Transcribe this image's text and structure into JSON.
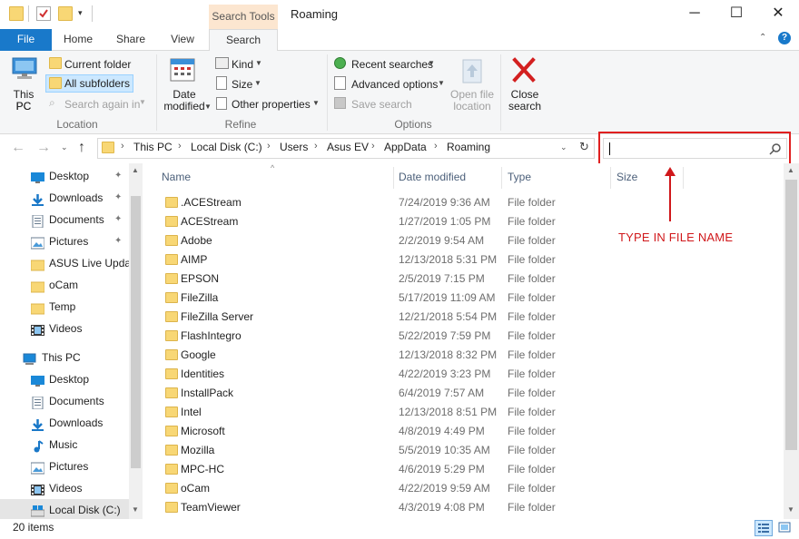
{
  "window": {
    "title": "Roaming",
    "context_tab": "Search Tools",
    "minimize": "─",
    "maximize": "☐",
    "close": "✕"
  },
  "ribbon_tabs": {
    "file": "File",
    "home": "Home",
    "share": "Share",
    "view": "View",
    "search": "Search"
  },
  "ribbon": {
    "location": {
      "this_pc": "This PC",
      "current_folder": "Current folder",
      "all_subfolders": "All subfolders",
      "search_again": "Search again in",
      "group_label": "Location"
    },
    "refine": {
      "date_modified_1": "Date",
      "date_modified_2": "modified",
      "kind": "Kind",
      "size": "Size",
      "other_properties": "Other properties",
      "group_label": "Refine"
    },
    "options": {
      "recent_searches": "Recent searches",
      "advanced_options": "Advanced options",
      "save_search": "Save search",
      "open_file_location_1": "Open file",
      "open_file_location_2": "location",
      "group_label": "Options"
    },
    "close_search_1": "Close",
    "close_search_2": "search"
  },
  "address": {
    "breadcrumbs": [
      "This PC",
      "Local Disk (C:)",
      "Users",
      "Asus EV",
      "AppData",
      "Roaming"
    ],
    "search_value": ""
  },
  "nav": {
    "quick_access": [
      {
        "label": "Desktop",
        "icon": "desktop-icon",
        "pinned": true
      },
      {
        "label": "Downloads",
        "icon": "download-icon",
        "pinned": true
      },
      {
        "label": "Documents",
        "icon": "documents-icon",
        "pinned": true
      },
      {
        "label": "Pictures",
        "icon": "pictures-icon",
        "pinned": true
      },
      {
        "label": "ASUS Live Updat",
        "icon": "folder-icon",
        "pinned": false
      },
      {
        "label": "oCam",
        "icon": "folder-icon",
        "pinned": false
      },
      {
        "label": "Temp",
        "icon": "folder-icon",
        "pinned": false
      },
      {
        "label": "Videos",
        "icon": "videos-icon",
        "pinned": false
      }
    ],
    "this_pc": "This PC",
    "this_pc_items": [
      {
        "label": "Desktop",
        "icon": "desktop-icon"
      },
      {
        "label": "Documents",
        "icon": "documents-icon"
      },
      {
        "label": "Downloads",
        "icon": "download-icon"
      },
      {
        "label": "Music",
        "icon": "music-icon"
      },
      {
        "label": "Pictures",
        "icon": "pictures-icon"
      },
      {
        "label": "Videos",
        "icon": "videos-icon"
      },
      {
        "label": "Local Disk (C:)",
        "icon": "drive-icon"
      }
    ],
    "pin_glyph": "📌"
  },
  "columns": {
    "name": "Name",
    "date_modified": "Date modified",
    "type": "Type",
    "size": "Size"
  },
  "files": [
    {
      "name": ".ACEStream",
      "date": "7/24/2019 9:36 AM",
      "type": "File folder"
    },
    {
      "name": "ACEStream",
      "date": "1/27/2019 1:05 PM",
      "type": "File folder"
    },
    {
      "name": "Adobe",
      "date": "2/2/2019 9:54 AM",
      "type": "File folder"
    },
    {
      "name": "AIMP",
      "date": "12/13/2018 5:31 PM",
      "type": "File folder"
    },
    {
      "name": "EPSON",
      "date": "2/5/2019 7:15 PM",
      "type": "File folder"
    },
    {
      "name": "FileZilla",
      "date": "5/17/2019 11:09 AM",
      "type": "File folder"
    },
    {
      "name": "FileZilla Server",
      "date": "12/21/2018 5:54 PM",
      "type": "File folder"
    },
    {
      "name": "FlashIntegro",
      "date": "5/22/2019 7:59 PM",
      "type": "File folder"
    },
    {
      "name": "Google",
      "date": "12/13/2018 8:32 PM",
      "type": "File folder"
    },
    {
      "name": "Identities",
      "date": "4/22/2019 3:23 PM",
      "type": "File folder"
    },
    {
      "name": "InstallPack",
      "date": "6/4/2019 7:57 AM",
      "type": "File folder"
    },
    {
      "name": "Intel",
      "date": "12/13/2018 8:51 PM",
      "type": "File folder"
    },
    {
      "name": "Microsoft",
      "date": "4/8/2019 4:49 PM",
      "type": "File folder"
    },
    {
      "name": "Mozilla",
      "date": "5/5/2019 10:35 AM",
      "type": "File folder"
    },
    {
      "name": "MPC-HC",
      "date": "4/6/2019 5:29 PM",
      "type": "File folder"
    },
    {
      "name": "oCam",
      "date": "4/22/2019 9:59 AM",
      "type": "File folder"
    },
    {
      "name": "TeamViewer",
      "date": "4/3/2019 4:08 PM",
      "type": "File folder"
    }
  ],
  "status": {
    "item_count": "20 items"
  },
  "annotation": {
    "text": "TYPE IN FILE NAME"
  },
  "colors": {
    "accent": "#1979ca",
    "annotation_red": "#e02020",
    "folder_yellow": "#f8d775"
  }
}
